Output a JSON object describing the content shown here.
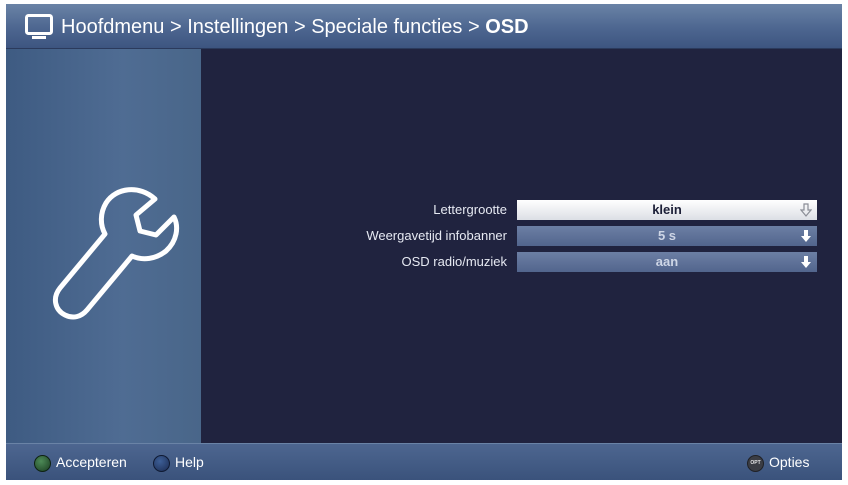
{
  "header": {
    "crumbs": [
      "Hoofdmenu",
      "Instellingen",
      "Speciale functies"
    ],
    "separator": ">",
    "current": "OSD",
    "icon": "tv-icon"
  },
  "sidebar": {
    "icon": "wrench-icon"
  },
  "settings": [
    {
      "label": "Lettergrootte",
      "value": "klein",
      "selected": true
    },
    {
      "label": "Weergavetijd infobanner",
      "value": "5 s",
      "selected": false
    },
    {
      "label": "OSD radio/muziek",
      "value": "aan",
      "selected": false
    }
  ],
  "footer": {
    "accept": "Accepteren",
    "help": "Help",
    "options_badge": "OPT",
    "options": "Opties"
  }
}
